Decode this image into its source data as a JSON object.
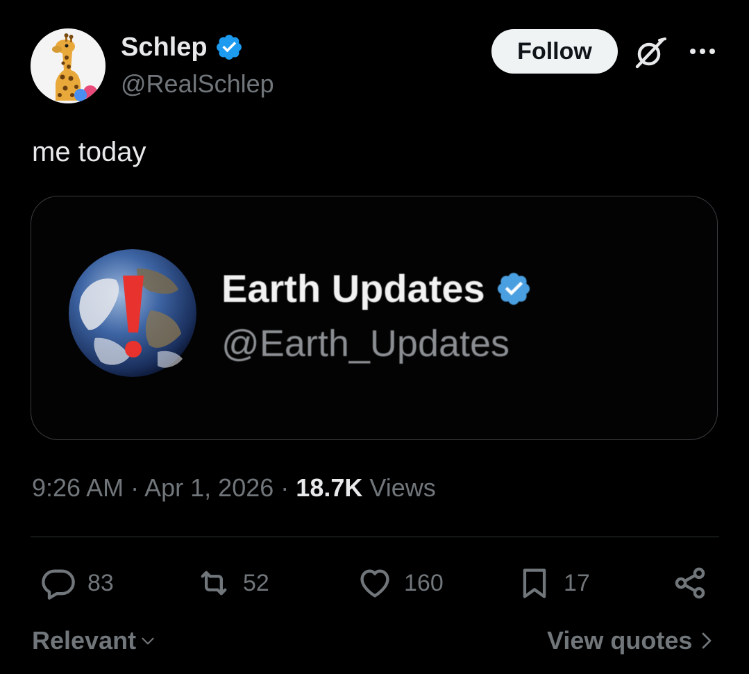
{
  "tweet": {
    "author": {
      "display_name": "Schlep",
      "handle": "@RealSchlep",
      "verified": true
    },
    "follow_label": "Follow",
    "text": "me today",
    "media": {
      "quoted_display_name": "Earth Updates",
      "quoted_handle": "@Earth_Updates"
    },
    "meta": {
      "time": "9:26 AM",
      "separator": "·",
      "date": "Apr 1, 2026",
      "views_count": "18.7K",
      "views_label": "Views"
    },
    "actions": {
      "replies": "83",
      "reposts": "52",
      "likes": "160",
      "bookmarks": "17"
    },
    "footer": {
      "sort_label": "Relevant",
      "view_quotes_label": "View quotes"
    }
  },
  "colors": {
    "background": "#000000",
    "primary_text": "#e7e9ea",
    "secondary_text": "#71767b",
    "verified_blue": "#1d9bf0",
    "follow_button_bg": "#eff3f4"
  },
  "icons": {
    "avatar": "giraffe-avatar",
    "verified": "verified-badge-icon",
    "grok": "grok-icon",
    "more": "more-icon",
    "reply": "reply-icon",
    "repost": "repost-icon",
    "like": "heart-icon",
    "bookmark": "bookmark-icon",
    "share": "share-icon"
  }
}
